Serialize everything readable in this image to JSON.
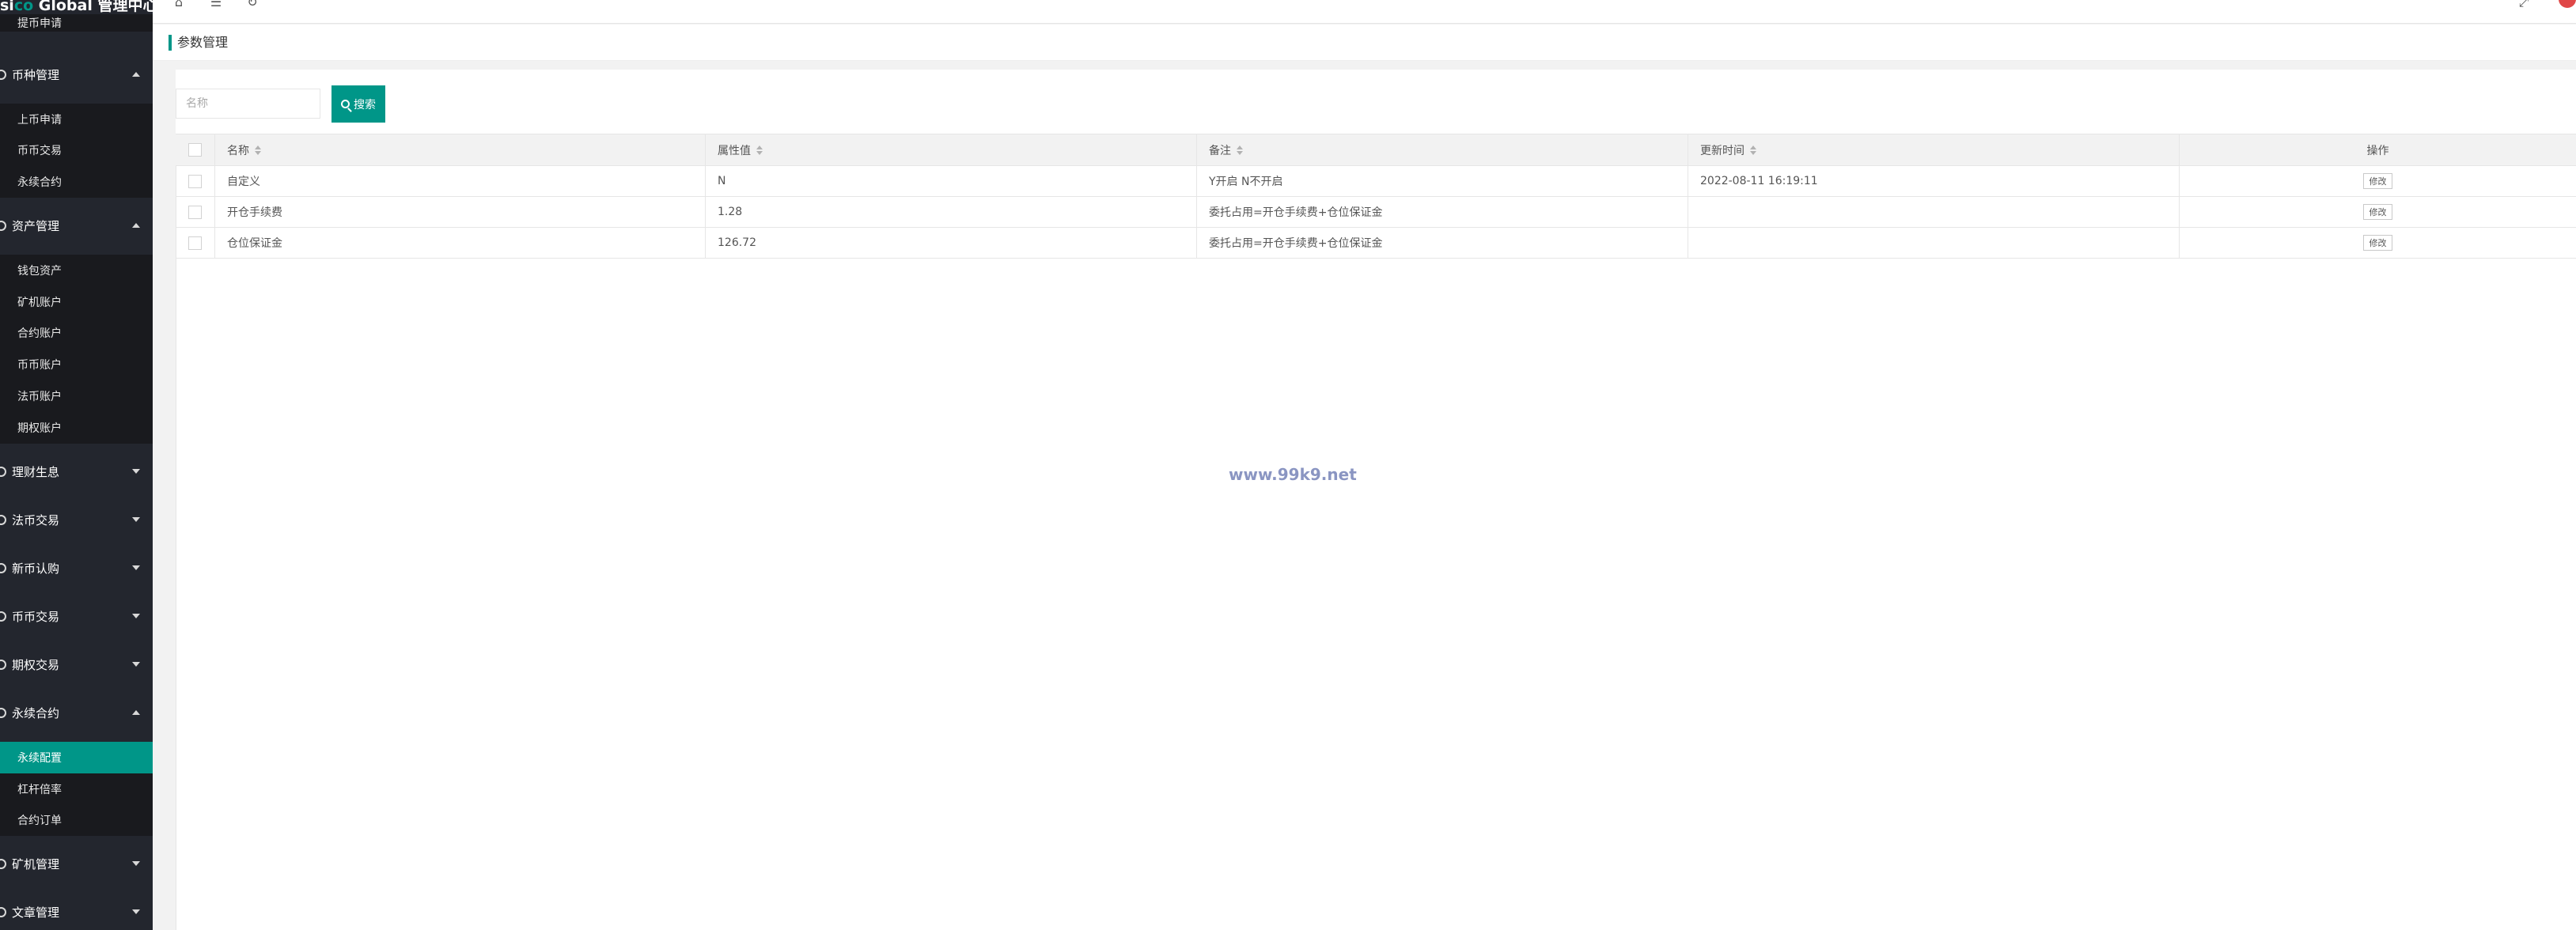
{
  "app": {
    "logo_prefix": "si",
    "logo_accent": "co",
    "logo_rest": " Global 管理中心"
  },
  "sidebar": {
    "top_sub": "提币申请",
    "groups": [
      {
        "label": "币种管理",
        "expanded": true,
        "items": [
          "上币申请",
          "币币交易",
          "永续合约"
        ]
      },
      {
        "label": "资产管理",
        "expanded": true,
        "items": [
          "钱包资产",
          "矿机账户",
          "合约账户",
          "币币账户",
          "法币账户",
          "期权账户"
        ]
      },
      {
        "label": "理财生息",
        "expanded": false
      },
      {
        "label": "法币交易",
        "expanded": false
      },
      {
        "label": "新币认购",
        "expanded": false
      },
      {
        "label": "币币交易",
        "expanded": false
      },
      {
        "label": "期权交易",
        "expanded": false
      },
      {
        "label": "永续合约",
        "expanded": true,
        "items": [
          "永续配置",
          "杠杆倍率",
          "合约订单"
        ],
        "active_item": "永续配置"
      },
      {
        "label": "矿机管理",
        "expanded": false
      },
      {
        "label": "文章管理",
        "expanded": false
      }
    ]
  },
  "topbar": {
    "icons": [
      "home-icon",
      "menu-fold-icon",
      "refresh-icon",
      "fullscreen-icon"
    ]
  },
  "breadcrumb": {
    "title": "参数管理"
  },
  "search": {
    "placeholder": "名称",
    "button_label": "搜索"
  },
  "table": {
    "headers": [
      "名称",
      "属性值",
      "备注",
      "更新时间",
      "操作"
    ],
    "rows": [
      {
        "name": "自定义",
        "value": "N",
        "remark": "Y开启 N不开启",
        "updated": "2022-08-11 16:19:11",
        "action": "修改"
      },
      {
        "name": "开仓手续费",
        "value": "1.28",
        "remark": "委托占用=开仓手续费+仓位保证金",
        "updated": "",
        "action": "修改"
      },
      {
        "name": "仓位保证金",
        "value": "126.72",
        "remark": "委托占用=开仓手续费+仓位保证金",
        "updated": "",
        "action": "修改"
      }
    ]
  },
  "watermark": "www.99k9.net",
  "colors": {
    "accent": "#009688",
    "sidebar_bg": "#23262e",
    "submenu_bg": "#191a1e"
  }
}
